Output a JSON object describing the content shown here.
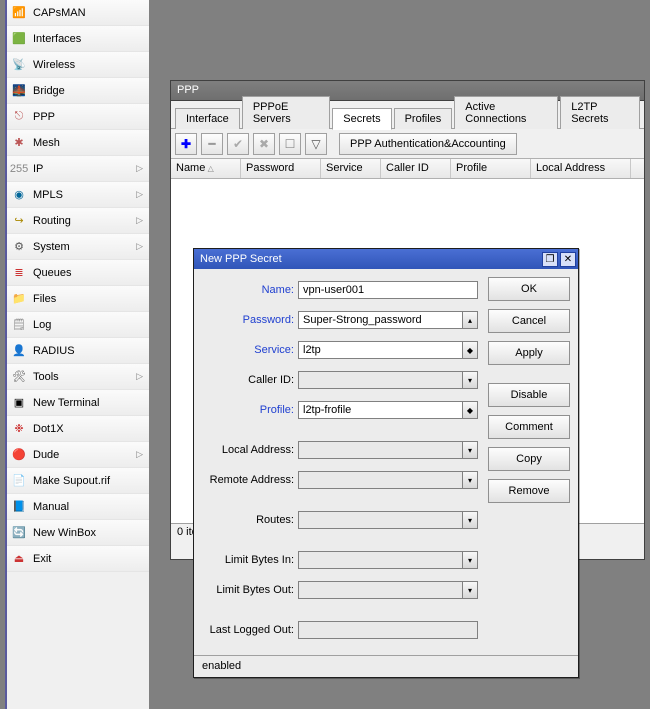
{
  "sidebar": {
    "items": [
      {
        "label": "CAPsMAN",
        "icon": "📶",
        "arrow": false,
        "color": "#555"
      },
      {
        "label": "Interfaces",
        "icon": "🟩",
        "arrow": false,
        "color": "#070"
      },
      {
        "label": "Wireless",
        "icon": "📡",
        "arrow": false,
        "color": "#888"
      },
      {
        "label": "Bridge",
        "icon": "🌉",
        "arrow": false,
        "color": "#59a"
      },
      {
        "label": "PPP",
        "icon": "⎋",
        "arrow": false,
        "color": "#b55"
      },
      {
        "label": "Mesh",
        "icon": "✱",
        "arrow": false,
        "color": "#b55"
      },
      {
        "label": "IP",
        "icon": "255",
        "arrow": true,
        "color": "#888"
      },
      {
        "label": "MPLS",
        "icon": "◉",
        "arrow": true,
        "color": "#069"
      },
      {
        "label": "Routing",
        "icon": "↪",
        "arrow": true,
        "color": "#a80"
      },
      {
        "label": "System",
        "icon": "⚙",
        "arrow": true,
        "color": "#555"
      },
      {
        "label": "Queues",
        "icon": "≣",
        "arrow": false,
        "color": "#c33"
      },
      {
        "label": "Files",
        "icon": "📁",
        "arrow": false,
        "color": "#c90"
      },
      {
        "label": "Log",
        "icon": "🗒",
        "arrow": false,
        "color": "#888"
      },
      {
        "label": "RADIUS",
        "icon": "👤",
        "arrow": false,
        "color": "#ca0"
      },
      {
        "label": "Tools",
        "icon": "🛠",
        "arrow": true,
        "color": "#555"
      },
      {
        "label": "New Terminal",
        "icon": "▣",
        "arrow": false,
        "color": "#000"
      },
      {
        "label": "Dot1X",
        "icon": "❉",
        "arrow": false,
        "color": "#c33"
      },
      {
        "label": "Dude",
        "icon": "🔴",
        "arrow": true,
        "color": "#c00"
      },
      {
        "label": "Make Supout.rif",
        "icon": "📄",
        "arrow": false,
        "color": "#c90"
      },
      {
        "label": "Manual",
        "icon": "📘",
        "arrow": false,
        "color": "#25c"
      },
      {
        "label": "New WinBox",
        "icon": "🔄",
        "arrow": false,
        "color": "#069"
      },
      {
        "label": "Exit",
        "icon": "⏏",
        "arrow": false,
        "color": "#c33"
      }
    ]
  },
  "ppp": {
    "title": "PPP",
    "tabs": [
      "Interface",
      "PPPoE Servers",
      "Secrets",
      "Profiles",
      "Active Connections",
      "L2TP Secrets"
    ],
    "active_tab": 2,
    "auth_button": "PPP Authentication&Accounting",
    "columns": [
      "Name",
      "Password",
      "Service",
      "Caller ID",
      "Profile",
      "Local Address"
    ],
    "status": "0 ite"
  },
  "dialog": {
    "title": "New PPP Secret",
    "fields": {
      "name": {
        "label": "Name:",
        "value": "vpn-user001"
      },
      "password": {
        "label": "Password:",
        "value": "Super-Strong_password"
      },
      "service": {
        "label": "Service:",
        "value": "l2tp"
      },
      "caller_id": {
        "label": "Caller ID:",
        "value": ""
      },
      "profile": {
        "label": "Profile:",
        "value": "l2tp-frofile"
      },
      "local_address": {
        "label": "Local Address:",
        "value": ""
      },
      "remote_address": {
        "label": "Remote Address:",
        "value": ""
      },
      "routes": {
        "label": "Routes:",
        "value": ""
      },
      "limit_bytes_in": {
        "label": "Limit Bytes In:",
        "value": ""
      },
      "limit_bytes_out": {
        "label": "Limit Bytes Out:",
        "value": ""
      },
      "last_logged_out": {
        "label": "Last Logged Out:",
        "value": ""
      }
    },
    "buttons": {
      "ok": "OK",
      "cancel": "Cancel",
      "apply": "Apply",
      "disable": "Disable",
      "comment": "Comment",
      "copy": "Copy",
      "remove": "Remove"
    },
    "status": "enabled"
  }
}
